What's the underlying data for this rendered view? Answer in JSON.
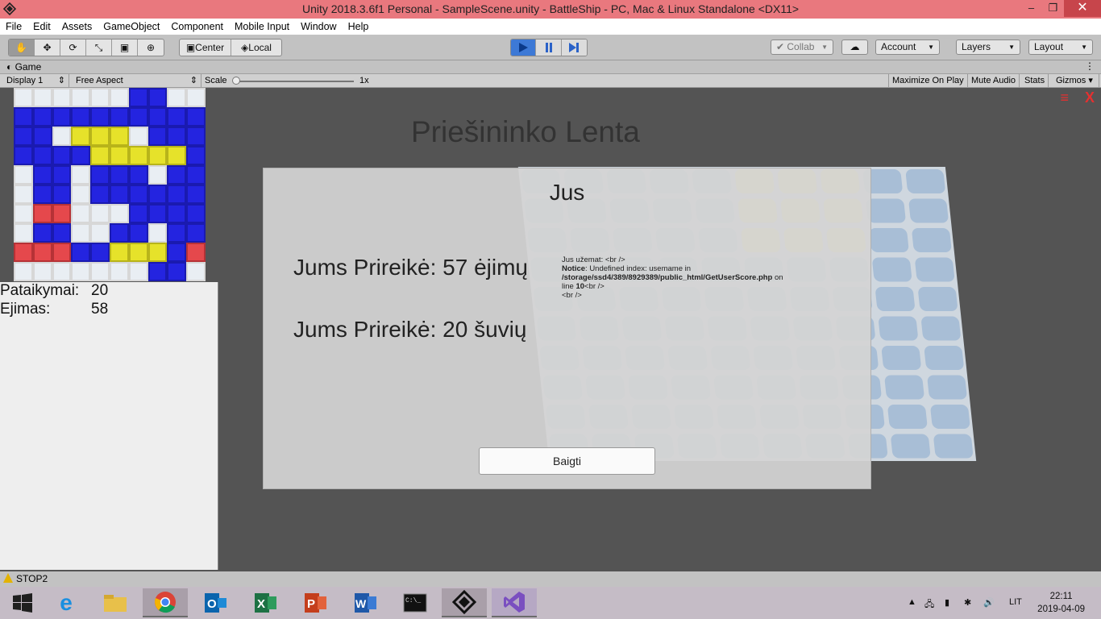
{
  "window": {
    "title": "Unity 2018.3.6f1 Personal - SampleScene.unity - BattleShip - PC, Mac & Linux Standalone <DX11>",
    "buttons": [
      "–",
      "❐",
      "✕"
    ]
  },
  "menu": [
    "File",
    "Edit",
    "Assets",
    "GameObject",
    "Component",
    "Mobile Input",
    "Window",
    "Help"
  ],
  "toolbar": {
    "pivot_center": "Center",
    "pivot_local": "Local",
    "collab": "Collab",
    "account": "Account",
    "layers": "Layers",
    "layout": "Layout"
  },
  "game_tab": {
    "label": "Game",
    "display": "Display 1",
    "aspect": "Free Aspect",
    "scale_label": "Scale",
    "scale_value": "1x",
    "maximize": "Maximize On Play",
    "mute": "Mute Audio",
    "stats": "Stats",
    "gizmos": "Gizmos"
  },
  "game": {
    "stats": [
      {
        "label": "Pataikymai:",
        "value": "20"
      },
      {
        "label": "Ejimas:",
        "value": "58"
      }
    ],
    "board_title": "Priešininko Lenta",
    "dialog": {
      "heading": "Jus",
      "line1": "Jums Prireikė: 57 ėjimų",
      "line2": "Jums Prireikė: 20 šuvių",
      "notice_l1": "Jus užemat: <br />",
      "notice_l2a": "Notice",
      "notice_l2b": ":  Undefined index: usemame in",
      "notice_l3a": "/storage/ssd4/389/8929389/public_html/GetUserScore.php",
      "notice_l3b": " on",
      "notice_l4a": "line ",
      "notice_l4b": "10",
      "notice_l4c": "<br />",
      "notice_l5": "<br />",
      "button": "Baigti"
    },
    "corner_menu": "≡",
    "corner_close": "X",
    "minimap_rows": [
      "wwwwwwbbww",
      "bbbbbbbbbb",
      "bbwyyywbbb",
      "bbbbyyyyyb",
      "wbbwbbbwbb",
      "wbbwbbbbbb",
      "wrrwwwbbbb",
      "wbbwwbbwbb",
      "rrrbbyyybr",
      "wwwwwwwbbw"
    ]
  },
  "status": {
    "text": "STOP2"
  },
  "taskbar": {
    "lang": "LIT",
    "time": "22:11",
    "date": "2019-04-09",
    "apps": [
      "start-icon",
      "ie-icon",
      "file-explorer-icon",
      "chrome-icon",
      "outlook-icon",
      "excel-icon",
      "powerpoint-icon",
      "word-icon",
      "cmd-icon",
      "unity-icon",
      "visual-studio-icon"
    ]
  },
  "colors": {
    "titlebar": "#e9787e",
    "play_active": "#3d79d6",
    "ship_blue": "#2424e0",
    "ship_yellow": "#e6e22a",
    "ship_red": "#e5484c"
  }
}
